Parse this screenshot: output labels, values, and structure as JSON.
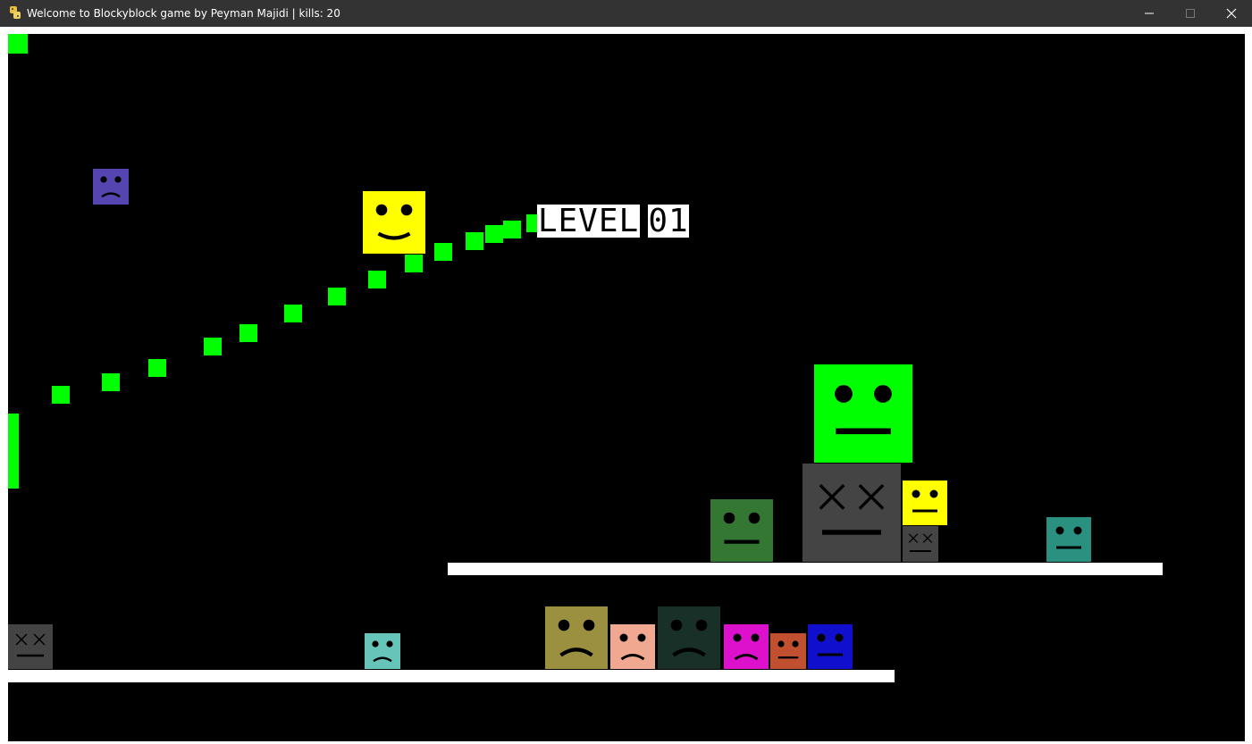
{
  "window": {
    "title": "Welcome to Blockyblock game by Peyman Majidi | kills: 20",
    "app_icon": "python-icon",
    "controls": [
      "minimize-icon",
      "maximize-icon",
      "close-icon"
    ]
  },
  "hud": {
    "level_label": "LEVEL",
    "level_number": "01"
  },
  "colors": {
    "background": "#000000",
    "platform": "#ffffff",
    "trail": "#00ff00"
  },
  "entities": [
    {
      "name": "purple-sad-block",
      "color": "#5545b0",
      "mood": "sad"
    },
    {
      "name": "yellow-happy-block",
      "color": "#ffff00",
      "mood": "happy"
    },
    {
      "name": "green-neutral-big-block",
      "color": "#00ff00",
      "mood": "neutral"
    },
    {
      "name": "gray-dead-big-block",
      "color": "#444444",
      "mood": "dead"
    },
    {
      "name": "yellow-neutral-small-block",
      "color": "#ffff00",
      "mood": "neutral"
    },
    {
      "name": "gray-dead-small-block",
      "color": "#444444",
      "mood": "dead"
    },
    {
      "name": "darkgreen-neutral-block",
      "color": "#337733",
      "mood": "neutral"
    },
    {
      "name": "teal-neutral-block",
      "color": "#2a9080",
      "mood": "neutral"
    },
    {
      "name": "gray-dead-left-block",
      "color": "#444444",
      "mood": "dead"
    },
    {
      "name": "cyan-sad-block",
      "color": "#66c4b8",
      "mood": "sad"
    },
    {
      "name": "olive-sad-block",
      "color": "#9a9040",
      "mood": "sad"
    },
    {
      "name": "peach-sad-block",
      "color": "#f0a890",
      "mood": "sad"
    },
    {
      "name": "darkteal-sad-block",
      "color": "#183028",
      "mood": "sad"
    },
    {
      "name": "magenta-sad-block",
      "color": "#dd11cc",
      "mood": "sad"
    },
    {
      "name": "rust-neutral-block",
      "color": "#c05030",
      "mood": "neutral"
    },
    {
      "name": "blue-neutral-block",
      "color": "#1010cc",
      "mood": "neutral"
    }
  ]
}
